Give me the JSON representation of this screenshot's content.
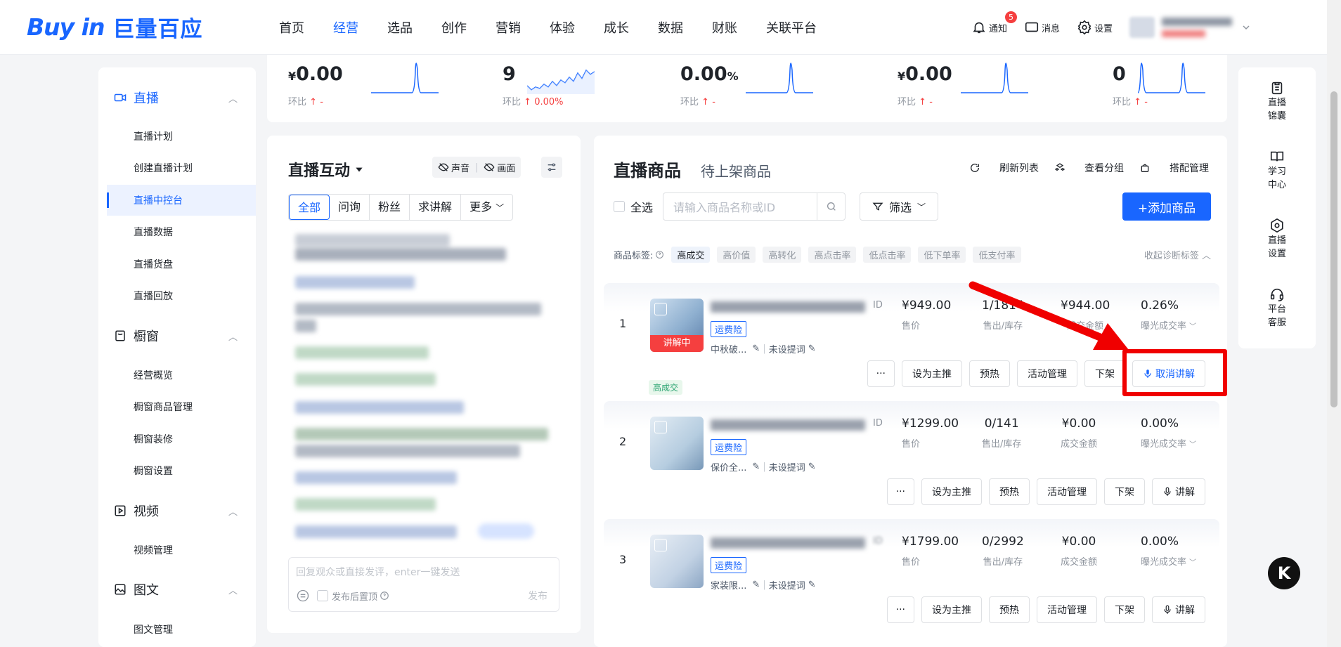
{
  "brand": {
    "logo_en": "Buy in",
    "logo_cn": "巨量百应"
  },
  "nav": [
    "首页",
    "经营",
    "选品",
    "创作",
    "营销",
    "体验",
    "成长",
    "数据",
    "财账",
    "关联平台"
  ],
  "nav_active": "经营",
  "top_right": {
    "notify_label": "通知",
    "notify_count": "5",
    "message_label": "消息",
    "settings_label": "设置"
  },
  "sidebar": {
    "sections": [
      {
        "label": "直播",
        "items": [
          "直播计划",
          "创建直播计划",
          "直播中控台",
          "直播数据",
          "直播货盘",
          "直播回放"
        ]
      },
      {
        "label": "橱窗",
        "items": [
          "经营概览",
          "橱窗商品管理",
          "橱窗装修",
          "橱窗设置"
        ]
      },
      {
        "label": "视频",
        "items": [
          "视频管理"
        ]
      },
      {
        "label": "图文",
        "items": [
          "图文管理"
        ]
      }
    ],
    "active_item": "直播中控台"
  },
  "stats": [
    {
      "value_prefix": "¥",
      "value": "0.00",
      "value_suffix": "",
      "cmp_label": "环比",
      "cmp_value": "-"
    },
    {
      "value_prefix": "",
      "value": "9",
      "value_suffix": "",
      "cmp_label": "环比",
      "cmp_value": "0.00%"
    },
    {
      "value_prefix": "",
      "value": "0.00",
      "value_suffix": "%",
      "cmp_label": "环比",
      "cmp_value": "-"
    },
    {
      "value_prefix": "¥",
      "value": "0.00",
      "value_suffix": "",
      "cmp_label": "环比",
      "cmp_value": "-"
    },
    {
      "value_prefix": "",
      "value": "0",
      "value_suffix": "",
      "cmp_label": "环比",
      "cmp_value": "-"
    }
  ],
  "interaction": {
    "title": "直播互动",
    "sound_label": "声音",
    "picture_label": "画面",
    "tabs": [
      "全部",
      "问询",
      "粉丝",
      "求讲解",
      "更多"
    ],
    "reply_placeholder": "回复观众或直接发评，enter一键发送",
    "pin_label": "发布后置顶",
    "send_label": "发布"
  },
  "products_panel": {
    "tab_active": "直播商品",
    "tab_other": "待上架商品",
    "refresh_label": "刷新列表",
    "group_label": "查看分组",
    "match_label": "搭配管理",
    "select_all_label": "全选",
    "search_placeholder": "请输入商品名称或ID",
    "filter_label": "筛选",
    "add_label": "+添加商品",
    "tag_prefix": "商品标签:",
    "tags": [
      "高成交",
      "高价值",
      "高转化",
      "高点击率",
      "低点击率",
      "低下单率",
      "低支付率"
    ],
    "collapse_label": "收起诊断标签"
  },
  "products": [
    {
      "index": "1",
      "id_label": "ID",
      "freight": "运费险",
      "promo": "中秋破...",
      "prompt": "未设提词",
      "live_badge": "讲解中",
      "price": "¥949.00",
      "price_label": "售价",
      "sold": "1/1814",
      "sold_label": "售出/库存",
      "amount": "¥944.00",
      "amount_label": "成交金额",
      "rate": "0.26%",
      "rate_label": "曝光成交率",
      "tag": "高成交",
      "actions": [
        "···",
        "设为主推",
        "预热",
        "活动管理",
        "下架",
        "取消讲解"
      ]
    },
    {
      "index": "2",
      "id_label": "ID",
      "freight": "运费险",
      "promo": "保价全...",
      "prompt": "未设提词",
      "live_badge": "",
      "price": "¥1299.00",
      "price_label": "售价",
      "sold": "0/141",
      "sold_label": "售出/库存",
      "amount": "¥0.00",
      "amount_label": "成交金额",
      "rate": "0.00%",
      "rate_label": "曝光成交率",
      "tag": "",
      "actions": [
        "···",
        "设为主推",
        "预热",
        "活动管理",
        "下架",
        "讲解"
      ]
    },
    {
      "index": "3",
      "id_label": "ID",
      "freight": "运费险",
      "promo": "家装限...",
      "prompt": "未设提词",
      "live_badge": "",
      "price": "¥1799.00",
      "price_label": "售价",
      "sold": "0/2992",
      "sold_label": "售出/库存",
      "amount": "¥0.00",
      "amount_label": "成交金额",
      "rate": "0.00%",
      "rate_label": "曝光成交率",
      "tag": "",
      "actions": [
        "···",
        "设为主推",
        "预热",
        "活动管理",
        "下架",
        "讲解"
      ]
    }
  ],
  "right_rail": [
    {
      "label": "直播锦囊",
      "icon": "clipboard-icon"
    },
    {
      "label": "学习中心",
      "icon": "book-icon"
    },
    {
      "label": "直播设置",
      "icon": "hexagon-settings-icon"
    },
    {
      "label": "平台客服",
      "icon": "headset-icon"
    }
  ],
  "colors": {
    "accent": "#1966ff",
    "danger": "#f53f3f",
    "highlight_box": "#f00000",
    "success": "#2ba471"
  }
}
